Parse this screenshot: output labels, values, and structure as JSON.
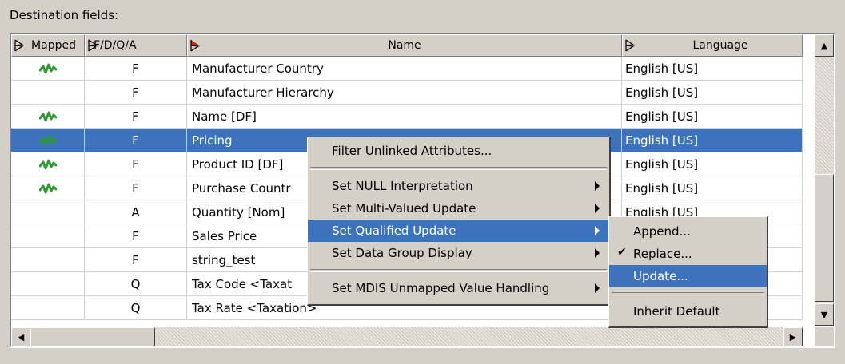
{
  "section_label": "Destination fields:",
  "columns": [
    "Mapped",
    "F/D/Q/A",
    "Name",
    "Language"
  ],
  "rows": [
    {
      "mapped": true,
      "type": "F",
      "name": "Manufacturer Country",
      "language": "English [US]"
    },
    {
      "mapped": false,
      "type": "F",
      "name": "Manufacturer Hierarchy",
      "language": "English [US]"
    },
    {
      "mapped": true,
      "type": "F",
      "name": "Name [DF]",
      "language": "English [US]"
    },
    {
      "mapped": true,
      "type": "F",
      "name": "Pricing",
      "language": "English [US]",
      "selected": true
    },
    {
      "mapped": true,
      "type": "F",
      "name": "Product ID [DF]",
      "language": "English [US]"
    },
    {
      "mapped": true,
      "type": "F",
      "name": "Purchase Countr",
      "language": "English [US]"
    },
    {
      "mapped": false,
      "type": "A",
      "name": "Quantity [Nom]",
      "language": "English [US]"
    },
    {
      "mapped": false,
      "type": "F",
      "name": "Sales Price",
      "language": ""
    },
    {
      "mapped": false,
      "type": "F",
      "name": "string_test",
      "language": ""
    },
    {
      "mapped": false,
      "type": "Q",
      "name": "Tax Code <Taxat",
      "language": ""
    },
    {
      "mapped": false,
      "type": "Q",
      "name": "Tax Rate <Taxation>",
      "language": ""
    }
  ],
  "context_menu": {
    "filter": "Filter Unlinked Attributes...",
    "null_interp": "Set NULL Interpretation",
    "multi_valued": "Set Multi-Valued Update",
    "qualified": "Set Qualified Update",
    "data_group": "Set Data Group Display",
    "mdis": "Set MDIS Unmapped Value Handling"
  },
  "submenu": {
    "append": "Append...",
    "replace": "Replace...",
    "update": "Update...",
    "inherit": "Inherit Default"
  },
  "colors": {
    "selection": "#3d73bd",
    "mapped_icon": "#2e9a2e"
  },
  "icons": {
    "mapped": "mapped-link-icon",
    "sort": "sort-arrow-icon"
  }
}
